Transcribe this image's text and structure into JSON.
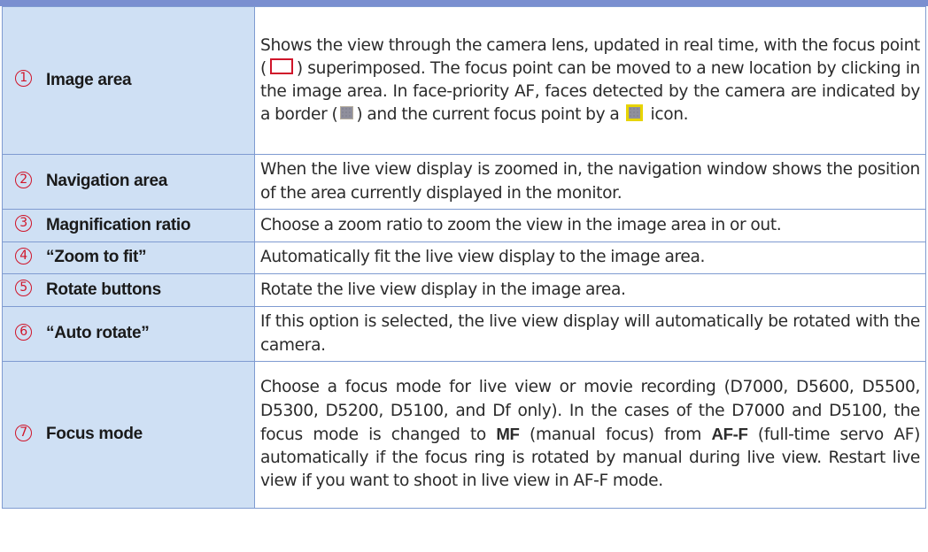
{
  "rows": [
    {
      "number": "1",
      "label": "Image area",
      "desc_parts": [
        "Shows the view through the camera lens, updated in real time, with the focus point (",
        ") superimposed. The focus point can be moved to a new location by clicking in the image area. In face-priority AF, faces detected by the camera are indicated by a border (",
        ") and the current focus point by a ",
        " icon."
      ]
    },
    {
      "number": "2",
      "label": "Navigation area",
      "desc": "When the live view display is zoomed in, the navigation window shows the position of the area currently displayed in the monitor."
    },
    {
      "number": "3",
      "label": "Magnification ratio",
      "desc": "Choose a zoom ratio to zoom the view in the image area in or out."
    },
    {
      "number": "4",
      "label": "“Zoom to fit”",
      "desc": "Automatically fit the live view display to the image area."
    },
    {
      "number": "5",
      "label": "Rotate buttons",
      "desc": "Rotate the live view display in the image area."
    },
    {
      "number": "6",
      "label": "“Auto rotate”",
      "desc": "If this option is selected, the live view display will automatically be rotated with the camera."
    },
    {
      "number": "7",
      "label": "Focus mode",
      "desc_parts": [
        "Choose a focus mode for live view or movie recording (D7000, D5600, D5500, D5300, D5200, D5100, and Df only). In the cases of the D7000 and D5100, the focus mode is changed to ",
        "MF",
        " (manual focus) from ",
        "AF-F",
        " (full-time servo AF) automatically if the focus ring is rotated by manual during live view. Restart live view if you want to shoot in live view in AF-F mode."
      ]
    }
  ],
  "icons": {
    "focus_point": "focus-point-icon",
    "face_border": "face-border-icon",
    "face_focus_point": "face-focus-point-icon"
  },
  "colors": {
    "label_bg": "#cfe0f4",
    "border": "#7f9bd1",
    "header_rule": "#7a8fd0",
    "number_red": "#d0152a",
    "face_focus_yellow": "#e7d400"
  }
}
